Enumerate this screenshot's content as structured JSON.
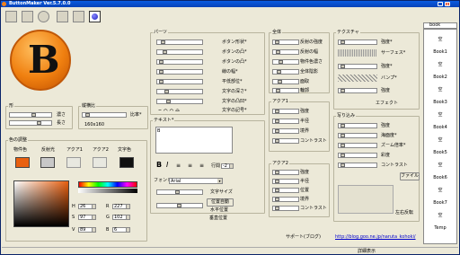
{
  "window": {
    "title": "ButtonMaker Ver.5.7.0.0"
  },
  "left": {
    "shape": {
      "title": "形",
      "dark": "濃さ",
      "length": "長さ",
      "ratio": "縦横比",
      "ratio_value": "比率*",
      "size": "160x160"
    },
    "color": {
      "title": "色の調整",
      "tabs": [
        "物件色",
        "反射光",
        "アクア1",
        "アクア2",
        "文字色"
      ],
      "colors": [
        "#e86010",
        "#c8c8c8",
        "#e8e8e0",
        "#e8e8e0",
        "#101010"
      ],
      "fields": [
        {
          "k": "H",
          "v": "26"
        },
        {
          "k": "R",
          "v": "227"
        },
        {
          "k": "S",
          "v": "97"
        },
        {
          "k": "G",
          "v": "102"
        },
        {
          "k": "V",
          "v": "89"
        },
        {
          "k": "B",
          "v": "6"
        }
      ]
    }
  },
  "parts": {
    "title": "パーツ",
    "rows": [
      "ボタン形状*",
      "ボタンの凸*",
      "ボタンの凸*",
      "線の幅*",
      "平低部位*",
      "文字の深さ*",
      "文字の凸凹*",
      "文字の記号*"
    ]
  },
  "all": {
    "title": "全体",
    "rows": [
      "反射の強度",
      "反射の幅",
      "物件色濃さ",
      "全体陰影",
      "面取",
      "輪郭"
    ]
  },
  "aqua1": {
    "title": "アクア1",
    "rows": [
      "強度",
      "半径",
      "境界",
      "コントラスト"
    ]
  },
  "aqua2": {
    "title": "アクア2",
    "rows": [
      "強度",
      "半径",
      "位置",
      "境界",
      "コントラスト"
    ]
  },
  "text": {
    "title": "テキスト*",
    "value": "B",
    "line_spacing": "行間",
    "line_value": "-2",
    "font_label": "フォント",
    "font_value": "Arial",
    "text_size": "文字サイズ",
    "auto_pos": "位置自動",
    "hpos": "水平位置",
    "vpos": "垂直位置"
  },
  "texture": {
    "title": "テクスチャ",
    "rows": [
      "強度*",
      "サーフェス*",
      "強度*",
      "バンプ*",
      "強度",
      "エフェクト"
    ]
  },
  "embed": {
    "title": "写り込み",
    "rows": [
      "強度",
      "海面度*",
      "ズーム倍率*",
      "彩度",
      "コントラスト"
    ],
    "file_btn": "ファイル",
    "flip": "左右反転"
  },
  "support": {
    "label": "サポート(ブログ)",
    "link": "http://blog.goo.ne.jp/naruta_kohoki/"
  },
  "status": {
    "detail": "詳細表示"
  },
  "list": {
    "header": "book",
    "items": [
      "空",
      "Book1",
      "空",
      "Book2",
      "空",
      "Book3",
      "空",
      "Book4",
      "空",
      "Book5",
      "空",
      "Book6",
      "空",
      "Book7",
      "空",
      "Temp"
    ]
  }
}
